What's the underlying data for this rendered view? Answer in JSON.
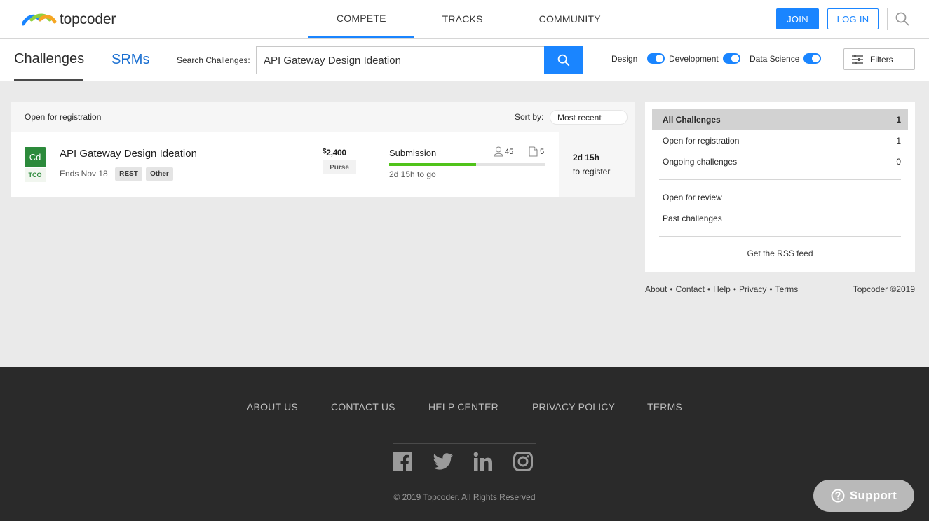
{
  "brand": {
    "name": "topcoder"
  },
  "nav": {
    "items": [
      {
        "label": "COMPETE",
        "active": true
      },
      {
        "label": "TRACKS",
        "active": false
      },
      {
        "label": "COMMUNITY",
        "active": false
      }
    ],
    "join_label": "JOIN",
    "login_label": "LOG IN"
  },
  "subheader": {
    "tabs": [
      {
        "label": "Challenges",
        "active": true
      },
      {
        "label": "SRMs",
        "active": false
      }
    ],
    "search_label": "Search Challenges:",
    "search_value": "API Gateway Design Ideation",
    "toggles": [
      {
        "label": "Design",
        "on": true
      },
      {
        "label": "Development",
        "on": true
      },
      {
        "label": "Data Science",
        "on": true
      }
    ],
    "filters_label": "Filters"
  },
  "list": {
    "status_label": "Open for registration",
    "sort_label": "Sort by:",
    "sort_value": "Most recent",
    "challenges": [
      {
        "track": "Cd",
        "event": "TCO",
        "title": "API Gateway Design Ideation",
        "ends": "Ends Nov 18",
        "tags": [
          "REST",
          "Other"
        ],
        "prize_currency": "$",
        "prize_amount": "2,400",
        "prize_label": "Purse",
        "phase": "Submission",
        "phase_progress": 0.56,
        "phase_time": "2d 15h to go",
        "registrants": "45",
        "submissions": "5",
        "register_time": "2d 15h",
        "register_text": "to register"
      }
    ]
  },
  "sidebar": {
    "items": [
      {
        "label": "All Challenges",
        "count": "1",
        "active": true
      },
      {
        "label": "Open for registration",
        "count": "1",
        "active": false
      },
      {
        "label": "Ongoing challenges",
        "count": "0",
        "active": false
      },
      {
        "label": "Open for review",
        "count": "",
        "active": false
      },
      {
        "label": "Past challenges",
        "count": "",
        "active": false
      }
    ],
    "rss_label": "Get the RSS feed",
    "footer_links": [
      "About",
      "Contact",
      "Help",
      "Privacy",
      "Terms"
    ],
    "separator": "•",
    "copyright": "Topcoder ©2019"
  },
  "footer": {
    "links": [
      "ABOUT US",
      "CONTACT US",
      "HELP CENTER",
      "PRIVACY POLICY",
      "TERMS"
    ],
    "social_icons": [
      "facebook-icon",
      "twitter-icon",
      "linkedin-icon",
      "instagram-icon"
    ],
    "copyright": "© 2019 Topcoder. All Rights Reserved"
  },
  "support": {
    "label": "Support"
  },
  "colors": {
    "accent": "#1a85ff",
    "track_code": "#2c8a3b",
    "progress": "#50c31a",
    "footer_bg": "#2a2a2a"
  }
}
